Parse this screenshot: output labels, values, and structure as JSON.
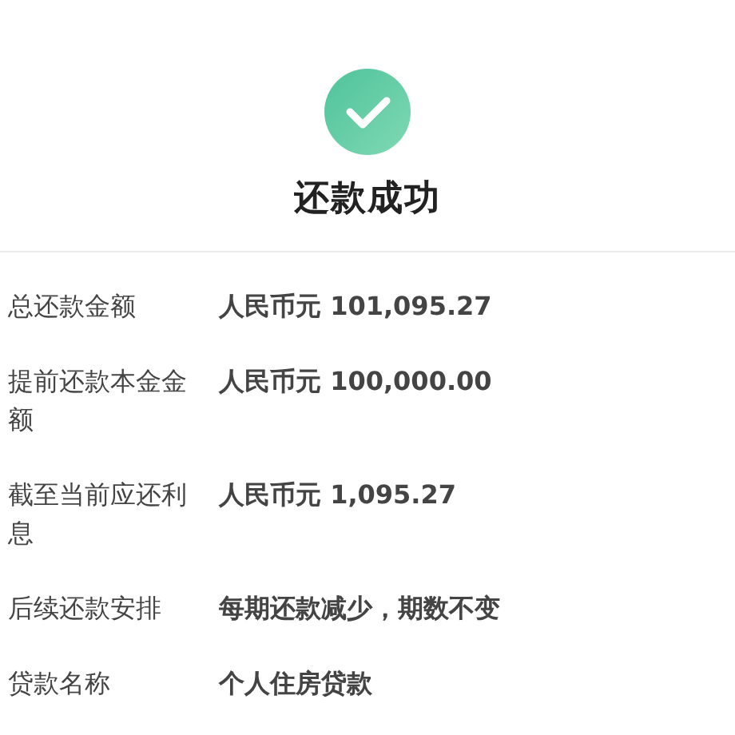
{
  "result": {
    "title": "还款成功"
  },
  "details": [
    {
      "label": "总还款金额",
      "value": "人民币元 101,095.27"
    },
    {
      "label": "提前还款本金金额",
      "value": "人民币元 100,000.00"
    },
    {
      "label": "截至当前应还利息",
      "value": "人民币元 1,095.27"
    },
    {
      "label": "后续还款安排",
      "value": "每期还款减少，期数不变"
    },
    {
      "label": "贷款名称",
      "value": "个人住房贷款"
    }
  ]
}
